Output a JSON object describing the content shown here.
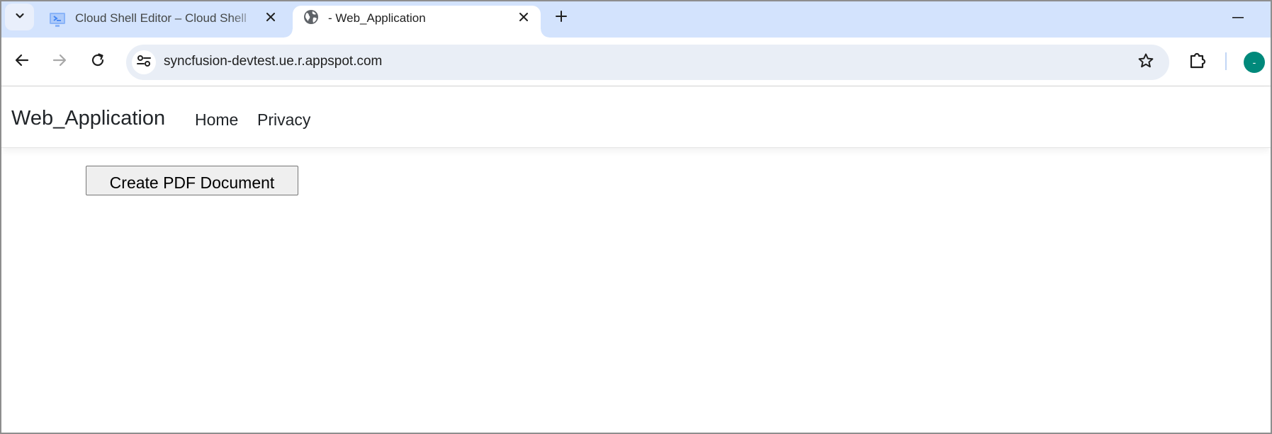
{
  "browser": {
    "tabs": [
      {
        "title": "Cloud Shell Editor – Cloud Shell",
        "favicon": "cloud-shell-icon",
        "active": false
      },
      {
        "title": "- Web_Application",
        "favicon": "globe-icon",
        "active": true
      }
    ],
    "address_bar": {
      "url": "syncfusion-devtest.ue.r.appspot.com"
    },
    "profile": {
      "initial": "-",
      "color": "#00897b"
    },
    "colors": {
      "tabstrip": "#d3e3fd",
      "omnibox": "#e9eef6"
    }
  },
  "site": {
    "brand": "Web_Application",
    "nav": {
      "home": "Home",
      "privacy": "Privacy"
    }
  },
  "main": {
    "create_pdf_label": "Create PDF Document"
  }
}
